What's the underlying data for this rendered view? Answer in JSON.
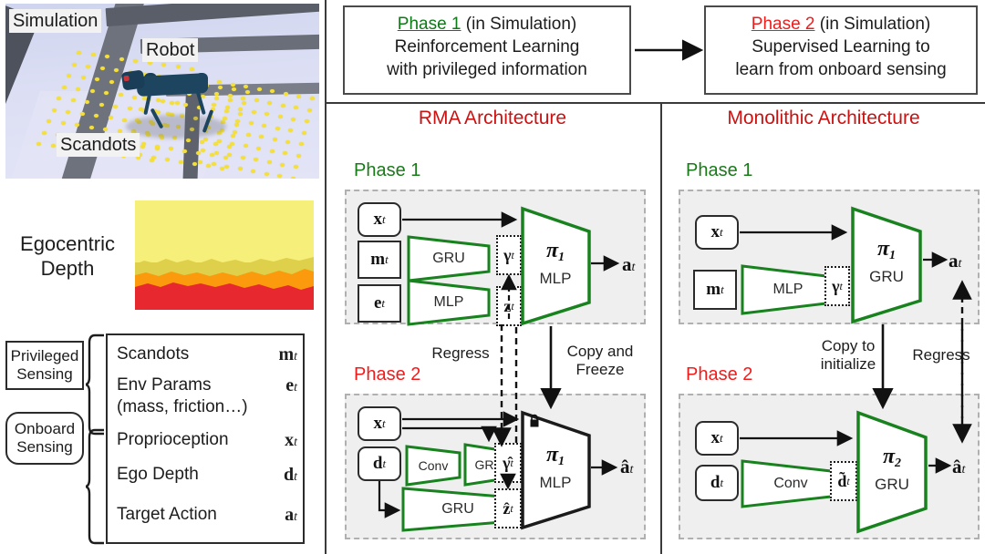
{
  "left_panel": {
    "simulation": {
      "labels": [
        {
          "name": "simulation",
          "text": "Simulation"
        },
        {
          "name": "robot",
          "text": "Robot"
        },
        {
          "name": "scandots",
          "text": "Scandots"
        }
      ]
    },
    "egocentric_depth": {
      "label_line1": "Egocentric",
      "label_line2": "Depth"
    },
    "sensing_groups": [
      {
        "name": "privileged",
        "line1": "Privileged",
        "line2": "Sensing"
      },
      {
        "name": "onboard",
        "line1": "Onboard",
        "line2": "Sensing"
      }
    ],
    "legend_rows": [
      {
        "label": "Scandots",
        "symbol": "m",
        "sub": "t"
      },
      {
        "label": "Env Params",
        "symbol": "e",
        "sub": "t"
      },
      {
        "label": "(mass, friction…)",
        "symbol": "",
        "sub": ""
      },
      {
        "label": "Proprioception",
        "symbol": "x",
        "sub": "t"
      },
      {
        "label": "Ego Depth",
        "symbol": "d",
        "sub": "t"
      },
      {
        "label": "Target Action",
        "symbol": "a",
        "sub": "t"
      }
    ]
  },
  "banners": {
    "phase1": {
      "head": "Phase 1",
      "head_suffix": " (in Simulation)",
      "line2": "Reinforcement Learning",
      "line3": "with privileged information",
      "head_color": "#0d7a16"
    },
    "phase2": {
      "head": "Phase 2",
      "head_suffix": " (in Simulation)",
      "line2": "Supervised Learning to",
      "line3": "learn from onboard sensing",
      "head_color": "#f01b1b"
    }
  },
  "rma": {
    "title": "RMA Architecture",
    "phase1_tag": "Phase 1",
    "phase2_tag": "Phase 2",
    "p1": {
      "in_x": "x",
      "in_x_sub": "t",
      "in_m": "m",
      "in_m_sub": "t",
      "in_e": "e",
      "in_e_sub": "t",
      "enc_m": "GRU",
      "enc_e": "MLP",
      "lat_gamma": "γ",
      "lat_gamma_sub": "t",
      "lat_z": "z",
      "lat_z_sub": "t",
      "policy_pi": "π",
      "policy_idx": "1",
      "policy_kind": "MLP",
      "out_a": "a",
      "out_a_sub": "t"
    },
    "p2": {
      "in_x": "x",
      "in_x_sub": "t",
      "in_d": "d",
      "in_d_sub": "t",
      "enc_conv": "Conv",
      "enc_gru1": "GRU",
      "enc_gru2": "GRU",
      "lat_gamma": "γ̂",
      "lat_gamma_sub": "t",
      "lat_z": "ẑ",
      "lat_z_sub": "t",
      "policy_pi": "π",
      "policy_idx": "1",
      "policy_kind": "MLP",
      "out_a": "â",
      "out_a_sub": "t"
    },
    "notes": {
      "regress": "Regress",
      "copy_l1": "Copy and",
      "copy_l2": "Freeze"
    }
  },
  "mono": {
    "title": "Monolithic Architecture",
    "phase1_tag": "Phase 1",
    "phase2_tag": "Phase 2",
    "p1": {
      "in_x": "x",
      "in_x_sub": "t",
      "in_m": "m",
      "in_m_sub": "t",
      "enc_m": "MLP",
      "lat_gamma": "γ",
      "lat_gamma_sub": "t",
      "policy_pi": "π",
      "policy_idx": "1",
      "policy_kind": "GRU",
      "out_a": "a",
      "out_a_sub": "t"
    },
    "p2": {
      "in_x": "x",
      "in_x_sub": "t",
      "in_d": "d",
      "in_d_sub": "t",
      "enc_conv": "Conv",
      "lat_d": "d̃",
      "lat_d_sub": "t",
      "policy_pi": "π",
      "policy_idx": "2",
      "policy_kind": "GRU",
      "out_a": "â",
      "out_a_sub": "t"
    },
    "notes": {
      "copy_l1": "Copy to",
      "copy_l2": "initialize",
      "regress": "Regress"
    }
  },
  "colors": {
    "accent_red": "#cc1111",
    "phase1_green": "#1a7a1a",
    "phase2_red": "#f01b1b",
    "encoder_green": "#18821e",
    "dashbox_fill": "#efefef",
    "scandot_yellow": "#f5e03a"
  }
}
